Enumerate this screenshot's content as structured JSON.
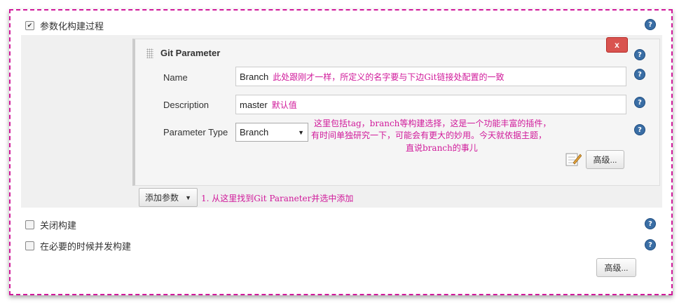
{
  "rows": {
    "parameterized": {
      "label": "参数化构建过程",
      "checked": true
    },
    "disable_build": {
      "label": "关闭构建",
      "checked": false
    },
    "concurrent_build": {
      "label": "在必要的时候并发构建",
      "checked": false
    }
  },
  "git_parameter": {
    "title": "Git Parameter",
    "delete_label": "x",
    "name": {
      "label": "Name",
      "value": "Branch",
      "annotation": "此处跟刚才一样，所定义的名字要与下边Git链接处配置的一致"
    },
    "description": {
      "label": "Description",
      "value": "master",
      "annotation": "默认值"
    },
    "parameter_type": {
      "label": "Parameter Type",
      "value": "Branch"
    },
    "type_note": [
      "这里包括tag，branch等构建选择，这是一个功能丰富的插件，",
      "有时间单独研究一下，可能会有更大的妙用。今天就依据主题，",
      "直说branch的事儿"
    ],
    "advanced_label": "高级..."
  },
  "add_param": {
    "label": "添加参数",
    "annotation": "1. 从这里找到Git Paraneter并选中添加"
  },
  "bottom_advanced_label": "高级...",
  "help_icon_glyph": "?",
  "colors": {
    "annotation": "#d0199a",
    "delete": "#d9534f",
    "help": "#3a6ea5"
  }
}
